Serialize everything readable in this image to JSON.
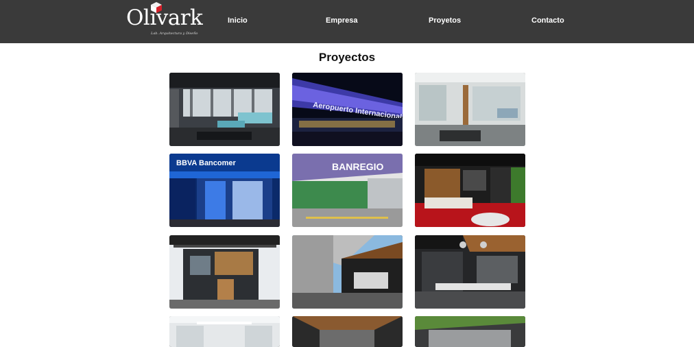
{
  "brand": {
    "name": "Olivark",
    "tagline": "Lab. Arquitectura y Diseño"
  },
  "nav": {
    "items": [
      "Inicio",
      "Empresa",
      "Proyetos",
      "Contacto"
    ]
  },
  "page": {
    "title": "Proyectos"
  },
  "projects": {
    "signs": {
      "airport": "Aeropuerto Internacional de",
      "bank": "BBVA Bancomer",
      "banregio": "BANREGIO"
    }
  },
  "colors": {
    "header_bg": "#3a3a3a",
    "logo_red": "#d6202a",
    "text": "#111111"
  }
}
